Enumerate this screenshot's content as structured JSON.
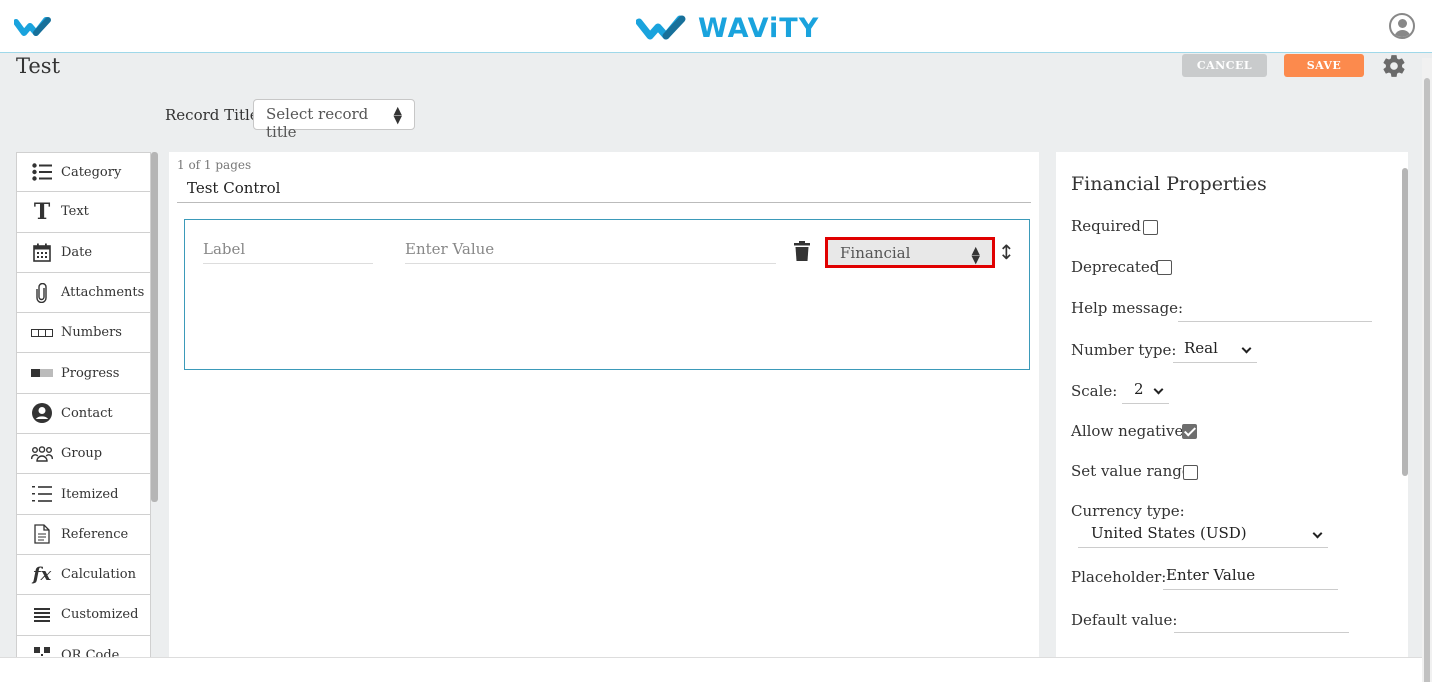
{
  "header": {
    "brand": "WAViTY"
  },
  "page": {
    "title": "Test"
  },
  "toolbar": {
    "cancel_label": "CANCEL",
    "save_label": "SAVE"
  },
  "record": {
    "label": "Record Title",
    "select_value": "Select record title"
  },
  "palette": {
    "items": [
      {
        "label": "Category",
        "icon": "list-icon"
      },
      {
        "label": "Text",
        "icon": "text-icon"
      },
      {
        "label": "Date",
        "icon": "calendar-icon"
      },
      {
        "label": "Attachments",
        "icon": "paperclip-icon"
      },
      {
        "label": "Numbers",
        "icon": "numbers-icon"
      },
      {
        "label": "Progress",
        "icon": "progress-icon"
      },
      {
        "label": "Contact",
        "icon": "contact-icon"
      },
      {
        "label": "Group",
        "icon": "group-icon"
      },
      {
        "label": "Itemized",
        "icon": "itemized-icon"
      },
      {
        "label": "Reference",
        "icon": "document-icon"
      },
      {
        "label": "Calculation",
        "icon": "function-icon"
      },
      {
        "label": "Customized",
        "icon": "menu-icon"
      },
      {
        "label": "QR Code",
        "icon": "qr-icon"
      }
    ]
  },
  "canvas": {
    "pages_info": "1 of 1 pages",
    "control_title": "Test Control",
    "label_placeholder": "Label",
    "value_placeholder": "Enter Value",
    "type_value": "Financial"
  },
  "properties": {
    "title": "Financial Properties",
    "required_label": "Required",
    "required_checked": false,
    "deprecated_label": "Deprecated",
    "deprecated_checked": false,
    "help_label": "Help message:",
    "help_value": "",
    "number_type_label": "Number type:",
    "number_type_value": "Real",
    "scale_label": "Scale:",
    "scale_value": "2",
    "allow_negative_label": "Allow negative",
    "allow_negative_checked": true,
    "value_range_label": "Set value range",
    "value_range_checked": false,
    "currency_label": "Currency type:",
    "currency_value": "United States (USD)",
    "placeholder_label": "Placeholder:",
    "placeholder_value": "Enter Value",
    "default_label": "Default value:",
    "default_value": ""
  },
  "colors": {
    "accent": "#1aa3dd",
    "save": "#fc8a4d",
    "highlight": "#e00000"
  }
}
